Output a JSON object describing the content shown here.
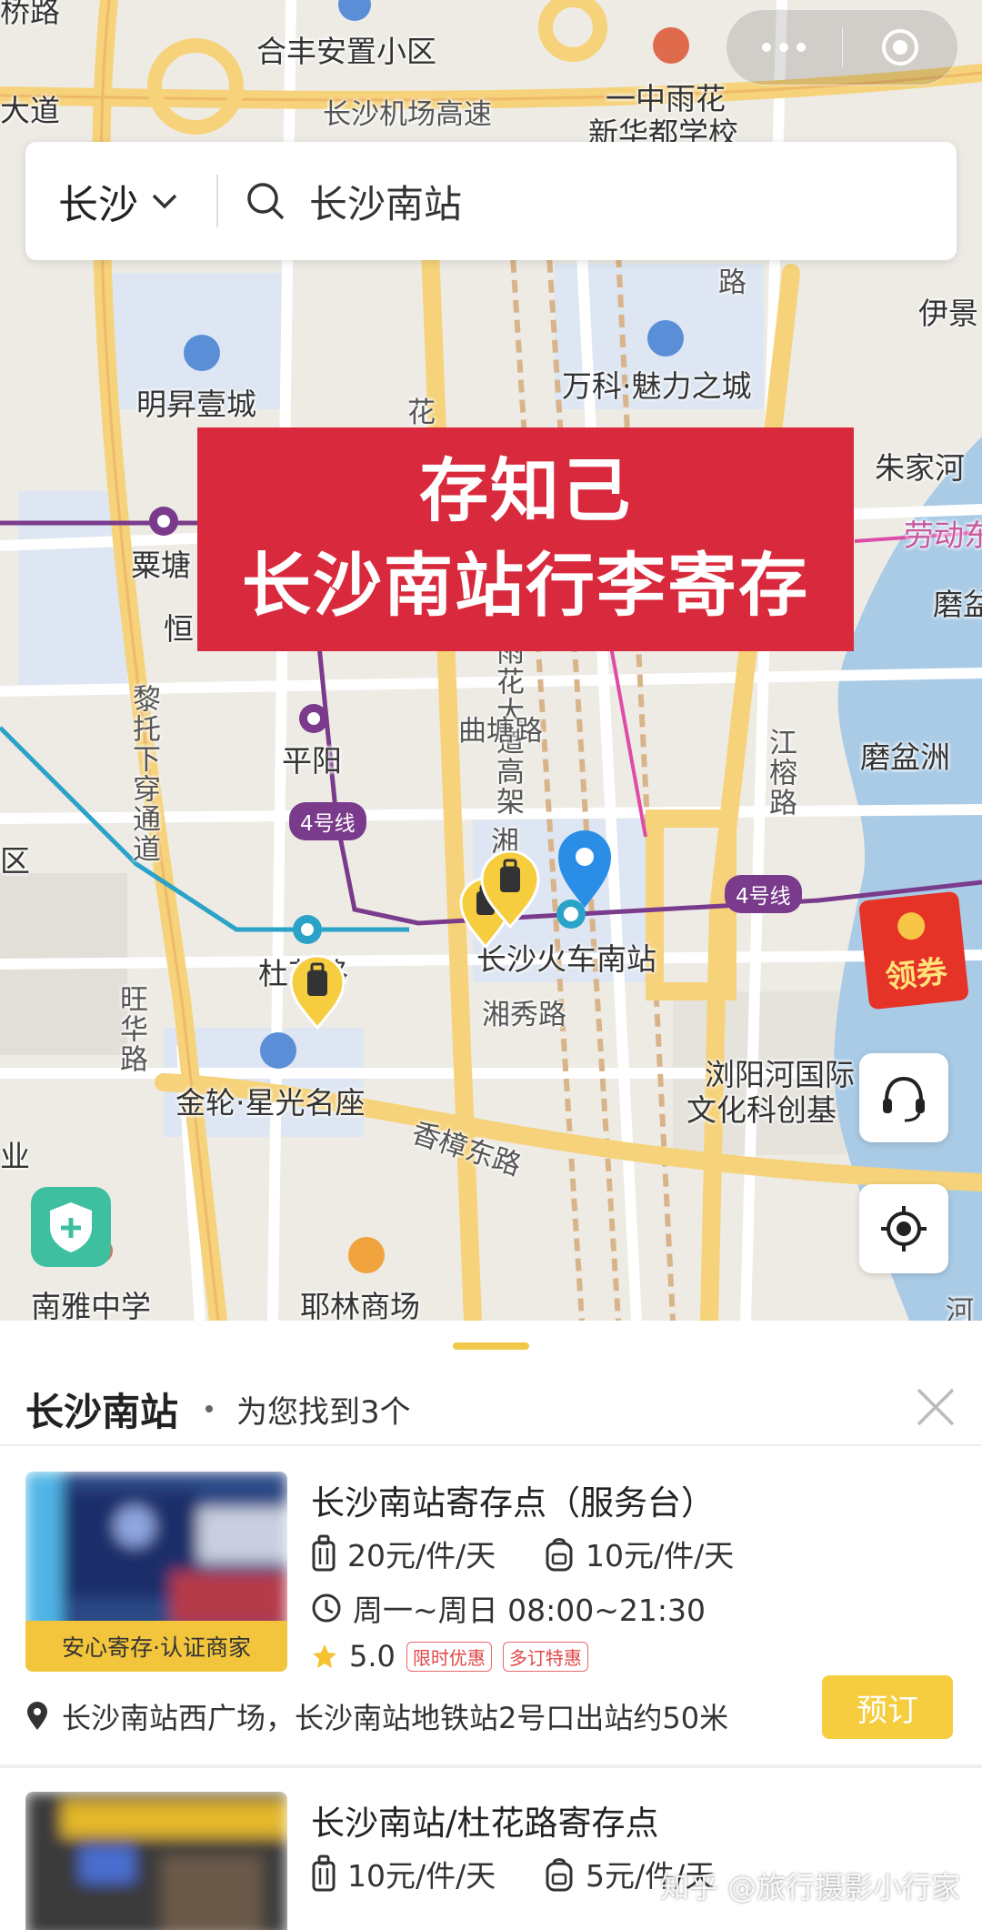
{
  "capsule": {
    "more_icon": "ellipsis-icon",
    "close_icon": "target-icon"
  },
  "search": {
    "city": "长沙",
    "query": "长沙南站"
  },
  "banner": {
    "line1": "存知己",
    "line2": "长沙南站行李寄存"
  },
  "map_labels": {
    "hefeng": "合丰安置小区",
    "airport_hwy": "长沙机场高速",
    "avenue": "大道",
    "yizhong": "一中雨花",
    "xinhuadu": "新华都学校",
    "top_left": "桥路",
    "mingsheng": "明昇壹城",
    "wanke": "万科·魅力之城",
    "yijing": "伊景",
    "zhujiahe": "朱家河",
    "laodong": "劳动东",
    "mopen_top": "磨盆",
    "mopenzhou": "磨盆洲",
    "sutang": "粟塘",
    "heng": "恒",
    "pingyang": "平阳",
    "qutang": "曲塘路",
    "jiangrong": "江榕路",
    "yuhua_elevated": "雨花大道高架",
    "litao": "黎托下穿通道",
    "line4_a": "4号线",
    "line4_b": "4号线",
    "xiang": "湘",
    "csnanstation": "长沙火车南站",
    "duhua": "杜花路",
    "xiangxiu": "湘秀路",
    "wanghua": "旺华路",
    "jinlun": "金轮·星光名座",
    "xiangzhang": "香樟东路",
    "liuyanghe": "浏阳河国际",
    "wenhua": "文化科创基",
    "qu": "区",
    "ye": "业",
    "nanya": "南雅中学",
    "yelin": "耶林商场",
    "hua": "花",
    "lu_top": "路",
    "he": "河"
  },
  "coupon": {
    "label": "领券"
  },
  "sheet": {
    "title": "长沙南站",
    "count_text": "为您找到3个"
  },
  "listings": [
    {
      "title": "长沙南站寄存点（服务台）",
      "luggage_price": "20元/件/天",
      "bag_price": "10元/件/天",
      "hours": "周一~周日 08:00~21:30",
      "rating": "5.0",
      "tags": [
        "限时优惠",
        "多订特惠"
      ],
      "ribbon": "安心寄存·认证商家",
      "address": "长沙南站西广场，长沙南站地铁站2号口出站约50米",
      "book_label": "预订"
    },
    {
      "title": "长沙南站/杜花路寄存点",
      "luggage_price": "10元/件/天",
      "bag_price": "5元/件/天"
    }
  ],
  "watermark": "知乎 @旅行摄影小行家",
  "colors": {
    "accent": "#f5cd3e",
    "banner": "#d92a3d",
    "line4": "#7a3b8c"
  }
}
